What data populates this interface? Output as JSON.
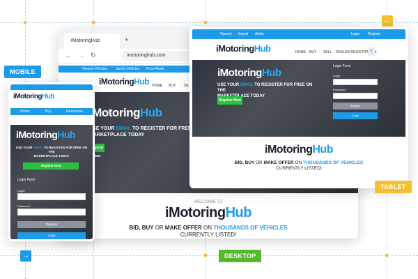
{
  "labels": {
    "mobile": "MOBILE",
    "tablet": "TABLET",
    "desktop": "DESKTOP"
  },
  "icons": {
    "left": "arrow-left-icon",
    "right": "arrow-right-icon"
  },
  "colors": {
    "accent": "#1e9be8",
    "green": "#2cc13d",
    "mobile_tag": "#1e9be8",
    "tablet_tag": "#f2c12e",
    "desktop_tag": "#55b72a"
  },
  "browser": {
    "tab_title": "iMotoringHub",
    "new_tab": "+",
    "url": "imotoringhub.com"
  },
  "brand": {
    "prefix": "iMotoring",
    "suffix": "Hub",
    "domain": ".com"
  },
  "top_links": [
    "Viewed Vehicles",
    "Saved Vehicles",
    "Price Alerts"
  ],
  "tablet_top_links": [
    "Viewed",
    "Saved",
    "Alerts"
  ],
  "account_links": [
    "Login",
    "Register"
  ],
  "nav": [
    "HOME",
    "BUY",
    "SELL",
    "DEALER REGISTRATION"
  ],
  "desktop_nav": [
    "HOME",
    "BUY",
    "SE"
  ],
  "mobile_nav": [
    "Home",
    "Buy",
    "Resources"
  ],
  "hero": {
    "line1_pre": "USE YOUR",
    "line1_em": "EMAIL",
    "line1_post": "TO REGISTER FOR FREE ON THE",
    "line2": "MARKETPLACE TODAY",
    "register_btn": "Register Now"
  },
  "desktop_hero": {
    "line1_pre": "USE YOUR",
    "line1_em": "EMAIL",
    "line1_post": "TO REGISTER FOR FREE",
    "line2": "MARKETPLACE TODAY"
  },
  "login": {
    "title": "Login Form",
    "login_label": "Login:",
    "password_label": "Password:",
    "register_btn": "Register",
    "login_btn": "Login"
  },
  "welcome": {
    "title": "WELCOME TO",
    "tagline_a": "BID, BUY",
    "tagline_or": "OR",
    "tagline_b": "MAKE OFFER",
    "tagline_on": "ON",
    "tagline_c": "THOUSANDS OF VEHICLES",
    "tagline_end": "CURRENTLY LISTED!"
  }
}
